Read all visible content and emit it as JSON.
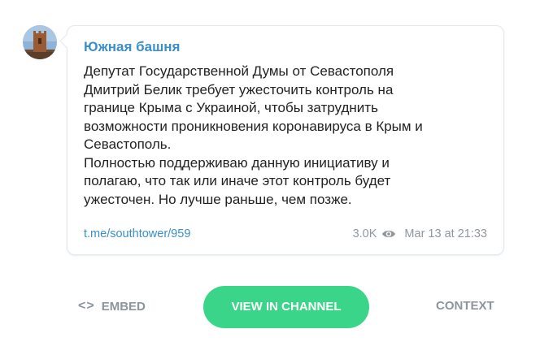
{
  "post": {
    "author": "Южная башня",
    "message_lines": [
      "Депутат Государственной Думы от Севастополя",
      "Дмитрий Белик требует ужесточить контроль на",
      "границе Крыма с Украиной, чтобы затруднить",
      "возможности проникновения коронавируса в Крым и",
      "Севастополь.",
      "Полностью поддерживаю данную инициативу и",
      "полагаю, что так или иначе этот контроль будет",
      "ужесточен. Но лучше раньше, чем позже."
    ],
    "link": "t.me/southtower/959",
    "views": "3.0K",
    "date": "Mar 13 at 21:33"
  },
  "icons": {
    "avatar": "tower-photo-avatar",
    "views": "eye-icon",
    "embed": "code-icon"
  },
  "actions": {
    "embed_icon": "<>",
    "embed_label": "EMBED",
    "view_label": "VIEW IN CHANNEL",
    "context_label": "CONTEXT"
  },
  "colors": {
    "accent": "#3a8fcb",
    "button": "#3bd589",
    "muted": "#8f979e",
    "text": "#222222"
  }
}
